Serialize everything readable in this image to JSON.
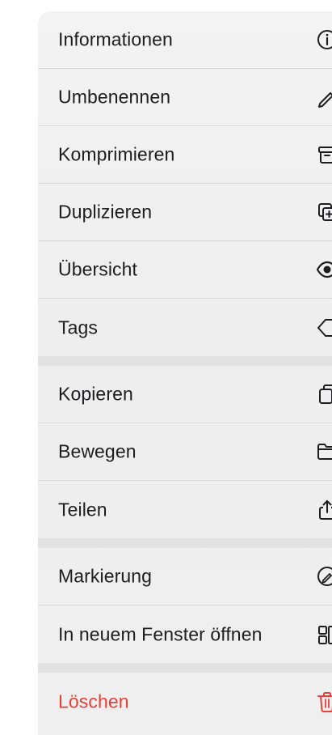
{
  "menu": {
    "group1": [
      {
        "label": "Informationen",
        "icon": "info-icon"
      },
      {
        "label": "Umbenennen",
        "icon": "pencil-icon"
      },
      {
        "label": "Komprimieren",
        "icon": "archive-icon"
      },
      {
        "label": "Duplizieren",
        "icon": "duplicate-icon"
      },
      {
        "label": "Übersicht",
        "icon": "eye-icon"
      },
      {
        "label": "Tags",
        "icon": "tag-icon"
      }
    ],
    "group2": [
      {
        "label": "Kopieren",
        "icon": "copy-icon"
      },
      {
        "label": "Bewegen",
        "icon": "folder-icon"
      },
      {
        "label": "Teilen",
        "icon": "share-icon"
      }
    ],
    "group3": [
      {
        "label": "Markierung",
        "icon": "markup-icon"
      },
      {
        "label": "In neuem Fenster öffnen",
        "icon": "new-window-icon"
      }
    ],
    "group4": [
      {
        "label": "Löschen",
        "icon": "trash-icon"
      }
    ]
  },
  "colors": {
    "text": "#1d1d1f",
    "danger": "#e84036",
    "separator": "#e2e2e2",
    "menu_background": "#efefef"
  }
}
